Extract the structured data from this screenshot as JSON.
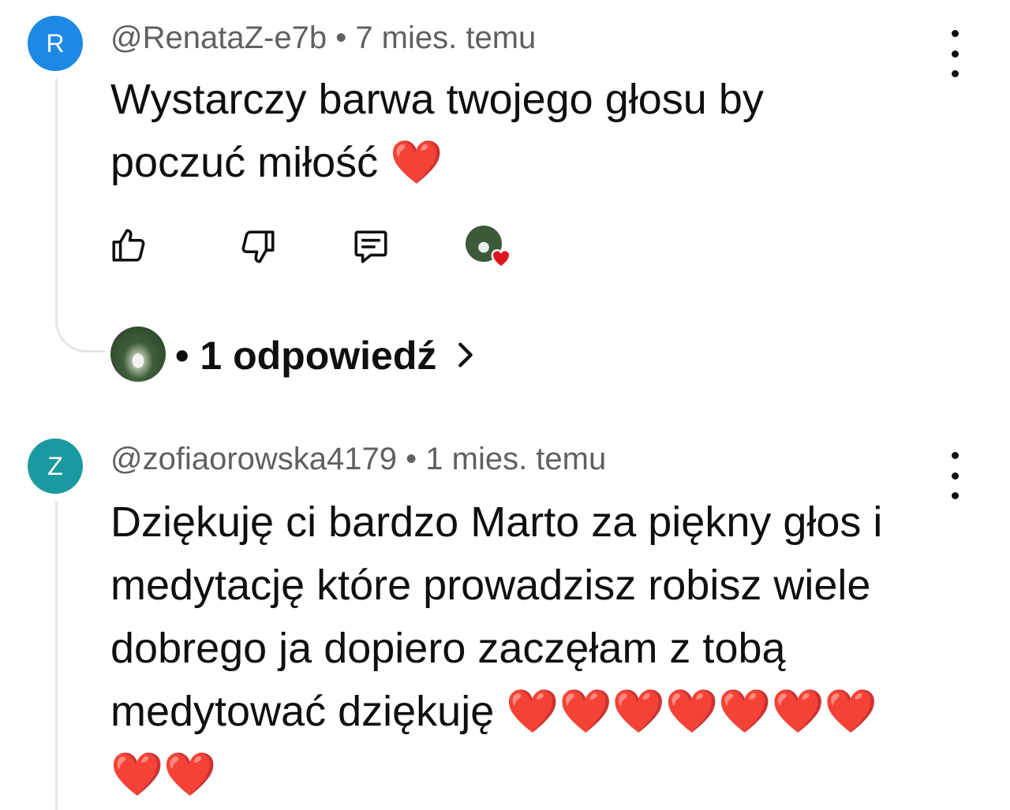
{
  "comments": [
    {
      "avatar_letter": "R",
      "avatar_color": "#1e88e5",
      "meta": "@RenataZ-e7b • 7 mies. temu",
      "text_line1": "Wystarczy barwa twojego głosu by",
      "text_line2": "poczuć miłość",
      "hearts": "❤️",
      "replies_label": "• 1 odpowiedź"
    },
    {
      "avatar_letter": "Z",
      "avatar_color": "#1a9aa0",
      "meta": "@zofiaorowska4179 • 1 mies. temu",
      "text_line1": "Dziękuję ci bardzo Marto za piękny głos i",
      "text_line2": "medytację które prowadzisz robisz wiele",
      "text_line3": "dobrego ja dopiero zaczęłam z tobą",
      "text_line4": "medytować dziękuję",
      "hearts_line4": "❤️❤️❤️❤️❤️❤️❤️",
      "hearts_line5": "❤️❤️"
    }
  ],
  "icons": {
    "like": "thumb-up-icon",
    "dislike": "thumb-down-icon",
    "reply": "comment-icon",
    "creator_heart": "creator-heart-icon",
    "more": "more-vertical-icon",
    "chevron": "chevron-right-icon"
  },
  "colors": {
    "meta_text": "#606060",
    "heart": "#e0141e",
    "thread_line": "#e5e5e5"
  }
}
